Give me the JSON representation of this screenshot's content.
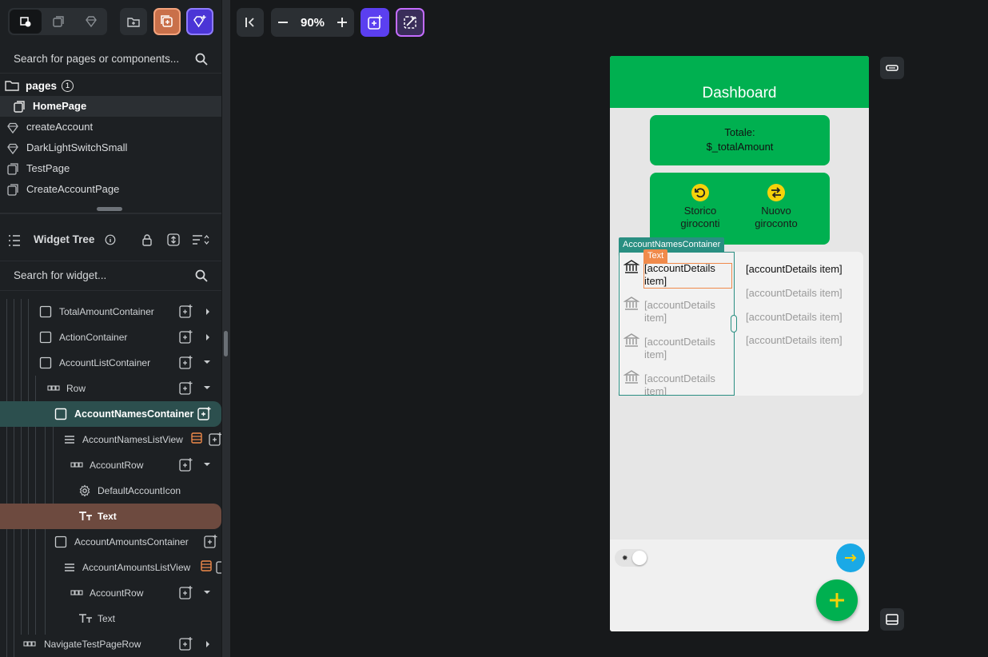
{
  "left_panel": {
    "search_pages_placeholder": "Search for pages or components...",
    "pages_header": "pages",
    "pages_count": "1",
    "pages": [
      {
        "label": "HomePage",
        "type": "page",
        "selected": true
      },
      {
        "label": "createAccount",
        "type": "component"
      },
      {
        "label": "DarkLightSwitchSmall",
        "type": "component"
      },
      {
        "label": "TestPage",
        "type": "page"
      },
      {
        "label": "CreateAccountPage",
        "type": "page"
      }
    ],
    "widget_tree_title": "Widget Tree",
    "search_widget_placeholder": "Search for widget...",
    "tree": [
      {
        "label": "TotalAmountContainer",
        "icon": "container-icon"
      },
      {
        "label": "ActionContainer",
        "icon": "container-icon"
      },
      {
        "label": "AccountListContainer",
        "icon": "container-icon"
      },
      {
        "label": "Row",
        "icon": "row-icon"
      },
      {
        "label": "AccountNamesContainer",
        "icon": "container-icon"
      },
      {
        "label": "AccountNamesListView",
        "icon": "listview-icon"
      },
      {
        "label": "AccountRow",
        "icon": "row-icon"
      },
      {
        "label": "DefaultAccountIcon",
        "icon": "gear-icon"
      },
      {
        "label": "Text",
        "icon": "text-icon"
      },
      {
        "label": "AccountAmountsContainer",
        "icon": "container-icon"
      },
      {
        "label": "AccountAmountsListView",
        "icon": "listview-icon"
      },
      {
        "label": "AccountRow",
        "icon": "row-icon"
      },
      {
        "label": "Text",
        "icon": "text-icon"
      },
      {
        "label": "NavigateTestPageRow",
        "icon": "row-icon"
      }
    ]
  },
  "canvas_toolbar": {
    "zoom": "90%"
  },
  "phone": {
    "appbar_title": "Dashboard",
    "total_label": "Totale:",
    "total_value": "$_totalAmount",
    "actions": [
      {
        "line1": "Storico",
        "line2": "giroconti",
        "icon": "history-icon"
      },
      {
        "line1": "Nuovo",
        "line2": "giroconto",
        "icon": "swap-icon"
      }
    ],
    "account_names": [
      "[accountDetails item]",
      "[accountDetails item]",
      "[accountDetails item]",
      "[accountDetails item]"
    ],
    "account_amounts": [
      "[accountDetails item]",
      "[accountDetails item]",
      "[accountDetails item]",
      "[accountDetails item]"
    ],
    "selection_tag_container": "AccountNamesContainer",
    "selection_tag_text": "Text"
  },
  "colors": {
    "brand_green": "#00b050",
    "accent_yellow": "#f5d20a",
    "nav_blue": "#1aa9e6",
    "teal_selection": "#2a8f82",
    "orange_selection": "#f08a4b",
    "purple_button": "#5b3ff0"
  }
}
